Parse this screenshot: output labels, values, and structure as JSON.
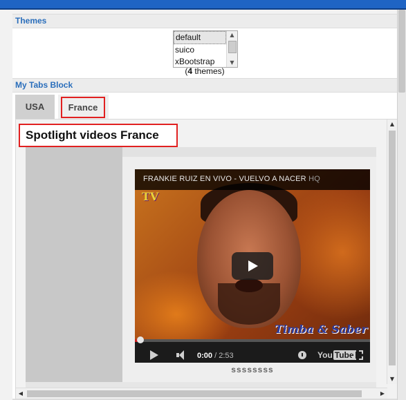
{
  "themes_block": {
    "title": "Themes",
    "options": [
      "default",
      "suico",
      "xBootstrap"
    ],
    "selected": "default",
    "count_prefix": "(",
    "count_number": "4",
    "count_suffix": " themes)"
  },
  "tabs_block": {
    "title": "My Tabs Block",
    "tabs": [
      "USA",
      "France"
    ],
    "active_tab": "France"
  },
  "spotlight": {
    "title": "Spotlight videos France",
    "video": {
      "title": "FRANKIE RUIZ EN VIVO -  VUELVO A NACER",
      "quality": "HQ",
      "logo_text": "TV",
      "watermark": "Timba & Saber",
      "current_time": "0:00",
      "duration": " / 2:53",
      "progress_fraction": 0.0,
      "youtube_label": "You",
      "youtube_box": "Tube"
    },
    "caption": "ssssssss"
  },
  "colors": {
    "topbar": "#1f64c4",
    "block_title_text": "#2a6ebb",
    "highlight_border": "#e12020"
  }
}
